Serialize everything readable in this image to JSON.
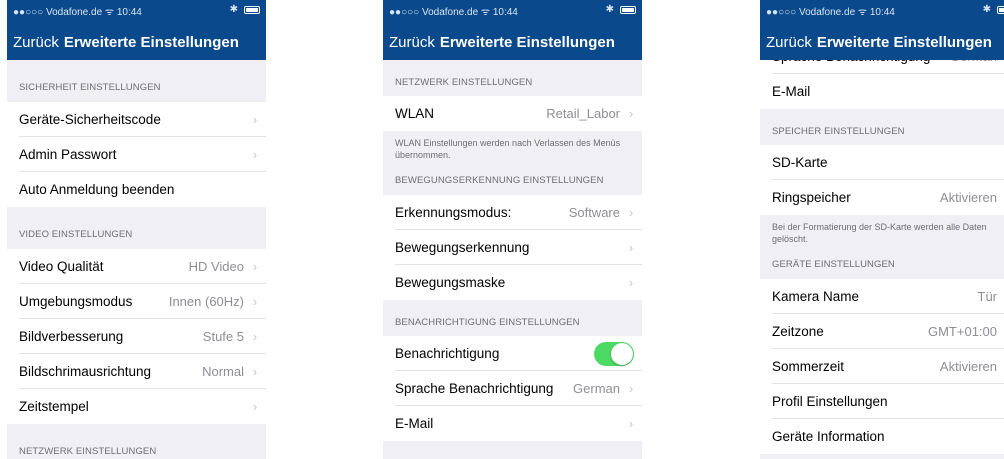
{
  "status_bar": {
    "carrier": "●●○○○ Vodafone.de ᯤ 10:44",
    "bluetooth": "✱"
  },
  "navbar": {
    "back_label": "Zurück",
    "title": "Erweiterte Einstellungen"
  },
  "screen1": {
    "security_header": "SICHERHEIT EINSTELLUNGEN",
    "device_code": "Geräte-Sicherheitscode",
    "admin_password": "Admin Passwort",
    "auto_logout": "Auto Anmeldung beenden",
    "video_header": "VIDEO EINSTELLUNGEN",
    "video_quality": {
      "label": "Video Qualität",
      "value": "HD Video"
    },
    "environment_mode": {
      "label": "Umgebungsmodus",
      "value": "Innen (60Hz)"
    },
    "image_enhancement": {
      "label": "Bildverbesserung",
      "value": "Stufe 5"
    },
    "screen_orientation": {
      "label": "Bildschrimausrichtung",
      "value": "Normal"
    },
    "timestamp": "Zeitstempel",
    "network_header": "NETZWERK EINSTELLUNGEN"
  },
  "screen2": {
    "network_header": "NETZWERK EINSTELLUNGEN",
    "wlan": {
      "label": "WLAN",
      "value": "Retail_Labor"
    },
    "wlan_note": "WLAN Einstellungen werden nach Verlassen des Menüs übernommen.",
    "motion_header": "BEWEGUNGSERKENNUNG EINSTELLUNGEN",
    "detection_mode": {
      "label": "Erkennungsmodus:",
      "value": "Software"
    },
    "motion_detection": "Bewegungserkennung",
    "motion_mask": "Bewegungsmaske",
    "notification_header": "BENACHRICHTIGUNG EINSTELLUNGEN",
    "notification": {
      "label": "Benachrichtigung",
      "enabled": true
    },
    "notification_language": {
      "label": "Sprache Benachrichtigung",
      "value": "German"
    },
    "email": "E-Mail"
  },
  "screen3": {
    "partial_row": {
      "label": "Sprache Benachrichtigung",
      "value": "German"
    },
    "email": "E-Mail",
    "storage_header": "SPEICHER EINSTELLUNGEN",
    "sd_card": "SD-Karte",
    "ring_buffer": {
      "label": "Ringspeicher",
      "value": "Aktivieren"
    },
    "format_note": "Bei der Formatierung der SD-Karte werden alle Daten gelöscht.",
    "device_header": "GERÄTE EINSTELLUNGEN",
    "camera_name": {
      "label": "Kamera Name",
      "value": "Tür"
    },
    "timezone": {
      "label": "Zeitzone",
      "value": "GMT+01:00"
    },
    "daylight_saving": {
      "label": "Sommerzeit",
      "value": "Aktivieren"
    },
    "profile_settings": "Profil Einstellungen",
    "device_info": "Geräte Information"
  },
  "colors": {
    "navbar": "#0a4a8c",
    "toggle_on": "#4cd964",
    "background": "#efeff4"
  },
  "icons": {
    "chevron": "›"
  }
}
